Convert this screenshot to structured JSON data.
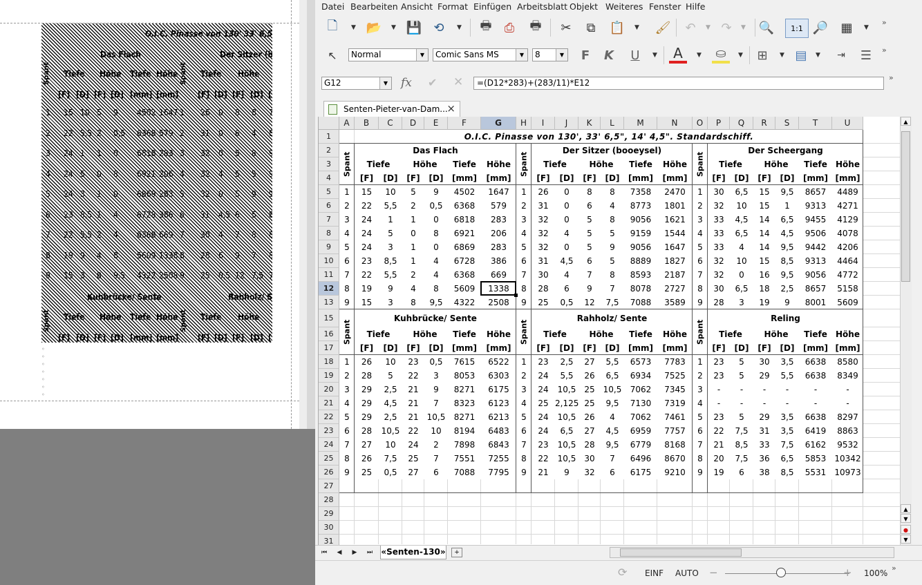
{
  "preview": {
    "title": "O.I.C. Pinasse von 130'  33' 6,5\"  14'",
    "sec1": "Das Flach",
    "sec2": "Der Sitzer (boey",
    "sec3": "Kuhbrücke/ Sente",
    "sec4": "Rahholz/ Sent",
    "h_tiefe": "Tiefe",
    "h_hoehe": "Höhe",
    "h_spant": "Spant",
    "units": [
      "[F]",
      "[D]",
      "[F]",
      "[D]",
      "[mm]",
      "[mm]"
    ],
    "units2": [
      "[F]",
      "[D]",
      "[F]",
      "[D]",
      "["
    ],
    "rows": [
      [
        "1",
        "15",
        "10",
        "5",
        "9",
        "4502",
        "1647",
        "1",
        "26",
        "0",
        "8",
        "8",
        "7"
      ],
      [
        "2",
        "22",
        "5,5",
        "2",
        "0,5",
        "6368",
        "579",
        "2",
        "31",
        "0",
        "6",
        "4",
        "8"
      ],
      [
        "3",
        "24",
        "1",
        "1",
        "0",
        "6818",
        "283",
        "3",
        "32",
        "0",
        "5",
        "8",
        "9"
      ],
      [
        "4",
        "24",
        "5",
        "0",
        "8",
        "6921",
        "206",
        "4",
        "32",
        "4",
        "5",
        "5",
        "9"
      ],
      [
        "5",
        "24",
        "3",
        "1",
        "0",
        "6869",
        "283",
        "5",
        "32",
        "0",
        "5",
        "9",
        "9"
      ],
      [
        "6",
        "23",
        "8,5",
        "1",
        "4",
        "6728",
        "386",
        "6",
        "31",
        "4,5",
        "6",
        "5",
        "8"
      ],
      [
        "7",
        "22",
        "5,5",
        "2",
        "4",
        "6368",
        "669",
        "7",
        "30",
        "4",
        "7",
        "8",
        "8"
      ],
      [
        "8",
        "19",
        "9",
        "4",
        "8",
        "5609",
        "1338",
        "8",
        "28",
        "6",
        "9",
        "7",
        "8"
      ],
      [
        "9",
        "15",
        "3",
        "8",
        "9,5",
        "4322",
        "2508",
        "9",
        "25",
        "0,5",
        "12",
        "7,5",
        "7"
      ]
    ]
  },
  "menu": [
    "Datei",
    "Bearbeiten",
    "Ansicht",
    "Format",
    "Einfügen",
    "Arbeitsblatt",
    "Objekt",
    "Weiteres",
    "Fenster",
    "Hilfe"
  ],
  "toolbar": {
    "style": "Normal",
    "font": "Comic Sans MS",
    "size": "8",
    "bold": "F",
    "italic": "K",
    "underline": "U",
    "zoom_btn": "1:1"
  },
  "formula_bar": {
    "cell": "G12",
    "fx": "fx",
    "formula": "=(D12*283)+(283/11)*E12"
  },
  "doc_tab": {
    "title": "Senten-Pieter-van-Dam..."
  },
  "columns": [
    "A",
    "B",
    "C",
    "D",
    "E",
    "F",
    "G",
    "H",
    "I",
    "J",
    "K",
    "L",
    "M",
    "N",
    "O",
    "P",
    "Q",
    "R",
    "S",
    "T",
    "U"
  ],
  "row_numbers": [
    "1",
    "2",
    "3",
    "4",
    "5",
    "6",
    "7",
    "8",
    "9",
    "10",
    "11",
    "12",
    "13",
    "15",
    "16",
    "17",
    "18",
    "19",
    "20",
    "21",
    "22",
    "23",
    "24",
    "25",
    "26",
    "27",
    "28",
    "29",
    "30",
    "31"
  ],
  "sheet": {
    "title": "O.I.C. Pinasse von 130', 33' 6,5\", 14' 4,5\". Standardschiff.",
    "block1": {
      "headers": [
        "Das Flach",
        "Der Sitzer (booeysel)",
        "Der Scheergang"
      ],
      "spant": "Spant",
      "tiefe": "Tiefe",
      "hoehe": "Höhe",
      "unit_f": "[F]",
      "unit_d": "[D]",
      "unit_mm": "[mm]",
      "rows": [
        [
          "1",
          "15",
          "10",
          "5",
          "9",
          "4502",
          "1647",
          "1",
          "26",
          "0",
          "8",
          "8",
          "7358",
          "2470",
          "1",
          "30",
          "6,5",
          "15",
          "9,5",
          "8657",
          "4489"
        ],
        [
          "2",
          "22",
          "5,5",
          "2",
          "0,5",
          "6368",
          "579",
          "2",
          "31",
          "0",
          "6",
          "4",
          "8773",
          "1801",
          "2",
          "32",
          "10",
          "15",
          "1",
          "9313",
          "4271"
        ],
        [
          "3",
          "24",
          "1",
          "1",
          "0",
          "6818",
          "283",
          "3",
          "32",
          "0",
          "5",
          "8",
          "9056",
          "1621",
          "3",
          "33",
          "4,5",
          "14",
          "6,5",
          "9455",
          "4129"
        ],
        [
          "4",
          "24",
          "5",
          "0",
          "8",
          "6921",
          "206",
          "4",
          "32",
          "4",
          "5",
          "5",
          "9159",
          "1544",
          "4",
          "33",
          "6,5",
          "14",
          "4,5",
          "9506",
          "4078"
        ],
        [
          "5",
          "24",
          "3",
          "1",
          "0",
          "6869",
          "283",
          "5",
          "32",
          "0",
          "5",
          "9",
          "9056",
          "1647",
          "5",
          "33",
          "4",
          "14",
          "9,5",
          "9442",
          "4206"
        ],
        [
          "6",
          "23",
          "8,5",
          "1",
          "4",
          "6728",
          "386",
          "6",
          "31",
          "4,5",
          "6",
          "5",
          "8889",
          "1827",
          "6",
          "32",
          "10",
          "15",
          "8,5",
          "9313",
          "4464"
        ],
        [
          "7",
          "22",
          "5,5",
          "2",
          "4",
          "6368",
          "669",
          "7",
          "30",
          "4",
          "7",
          "8",
          "8593",
          "2187",
          "7",
          "32",
          "0",
          "16",
          "9,5",
          "9056",
          "4772"
        ],
        [
          "8",
          "19",
          "9",
          "4",
          "8",
          "5609",
          "1338",
          "8",
          "28",
          "6",
          "9",
          "7",
          "8078",
          "2727",
          "8",
          "30",
          "6,5",
          "18",
          "2,5",
          "8657",
          "5158"
        ],
        [
          "9",
          "15",
          "3",
          "8",
          "9,5",
          "4322",
          "2508",
          "9",
          "25",
          "0,5",
          "12",
          "7,5",
          "7088",
          "3589",
          "9",
          "28",
          "3",
          "19",
          "9",
          "8001",
          "5609"
        ]
      ]
    },
    "block2": {
      "headers": [
        "Kuhbrücke/ Sente",
        "Rahholz/ Sente",
        "Reling"
      ],
      "rows": [
        [
          "1",
          "26",
          "10",
          "23",
          "0,5",
          "7615",
          "6522",
          "1",
          "23",
          "2,5",
          "27",
          "5,5",
          "6573",
          "7783",
          "1",
          "23",
          "5",
          "30",
          "3,5",
          "6638",
          "8580"
        ],
        [
          "2",
          "28",
          "5",
          "22",
          "3",
          "8053",
          "6303",
          "2",
          "24",
          "5,5",
          "26",
          "6,5",
          "6934",
          "7525",
          "2",
          "23",
          "5",
          "29",
          "5,5",
          "6638",
          "8349"
        ],
        [
          "3",
          "29",
          "2,5",
          "21",
          "9",
          "8271",
          "6175",
          "3",
          "24",
          "10,5",
          "25",
          "10,5",
          "7062",
          "7345",
          "3",
          "-",
          "-",
          "-",
          "-",
          "-",
          "-"
        ],
        [
          "4",
          "29",
          "4,5",
          "21",
          "7",
          "8323",
          "6123",
          "4",
          "25",
          "2,125",
          "25",
          "9,5",
          "7130",
          "7319",
          "4",
          "-",
          "-",
          "-",
          "-",
          "-",
          "-"
        ],
        [
          "5",
          "29",
          "2,5",
          "21",
          "10,5",
          "8271",
          "6213",
          "5",
          "24",
          "10,5",
          "26",
          "4",
          "7062",
          "7461",
          "5",
          "23",
          "5",
          "29",
          "3,5",
          "6638",
          "8297"
        ],
        [
          "6",
          "28",
          "10,5",
          "22",
          "10",
          "8194",
          "6483",
          "6",
          "24",
          "6,5",
          "27",
          "4,5",
          "6959",
          "7757",
          "6",
          "22",
          "7,5",
          "31",
          "3,5",
          "6419",
          "8863"
        ],
        [
          "7",
          "27",
          "10",
          "24",
          "2",
          "7898",
          "6843",
          "7",
          "23",
          "10,5",
          "28",
          "9,5",
          "6779",
          "8168",
          "7",
          "21",
          "8,5",
          "33",
          "7,5",
          "6162",
          "9532"
        ],
        [
          "8",
          "26",
          "7,5",
          "25",
          "7",
          "7551",
          "7255",
          "8",
          "22",
          "10,5",
          "30",
          "7",
          "6496",
          "8670",
          "8",
          "20",
          "7,5",
          "36",
          "6,5",
          "5853",
          "10342"
        ],
        [
          "9",
          "25",
          "0,5",
          "27",
          "6",
          "7088",
          "7795",
          "9",
          "21",
          "9",
          "32",
          "6",
          "6175",
          "9210",
          "9",
          "19",
          "6",
          "38",
          "8,5",
          "5531",
          "10973"
        ]
      ]
    }
  },
  "sheet_tab": "«Senten-130»",
  "status": {
    "mode": "EINF",
    "sel": "AUTO",
    "zoom": "100%",
    "minus": "−",
    "plus": "+"
  }
}
